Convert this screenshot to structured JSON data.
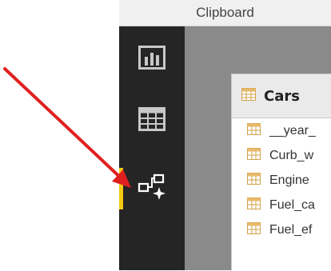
{
  "ribbon": {
    "group_label": "Clipboard"
  },
  "rail": {
    "items": [
      {
        "icon": "report-view-icon",
        "active": false
      },
      {
        "icon": "data-view-icon",
        "active": false
      },
      {
        "icon": "model-view-icon",
        "active": true
      }
    ]
  },
  "table": {
    "name": "Cars",
    "fields": [
      "__year_",
      "Curb_w",
      "Engine",
      "Fuel_ca",
      "Fuel_ef"
    ]
  },
  "colors": {
    "rail_bg": "#252526",
    "active_indicator": "#f2c811",
    "canvas_bg": "#8a8a8a",
    "annotation_arrow": "#e02020"
  }
}
